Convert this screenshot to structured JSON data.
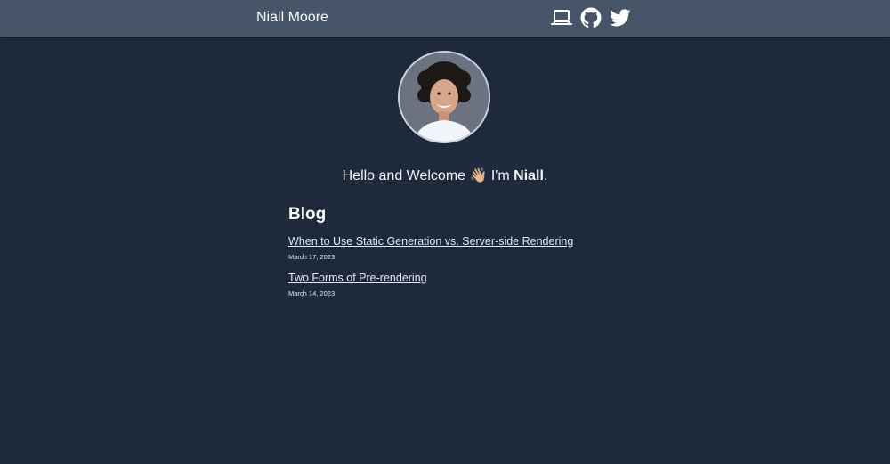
{
  "header": {
    "brand": "Niall Moore",
    "icons": [
      "laptop-icon",
      "github-icon",
      "twitter-icon"
    ]
  },
  "profile": {
    "greeting": "Hello and Welcome 👋🏼 I'm ",
    "name": "Niall",
    "punctuation": "."
  },
  "blog": {
    "heading": "Blog",
    "posts": [
      {
        "title": "When to Use Static Generation vs. Server-side Rendering",
        "date": "March 17, 2023"
      },
      {
        "title": "Two Forms of Pre-rendering",
        "date": "March 14, 2023"
      }
    ]
  },
  "colors": {
    "background": "#1e293b",
    "navbar": "#475569",
    "text": "#f8fafc"
  }
}
